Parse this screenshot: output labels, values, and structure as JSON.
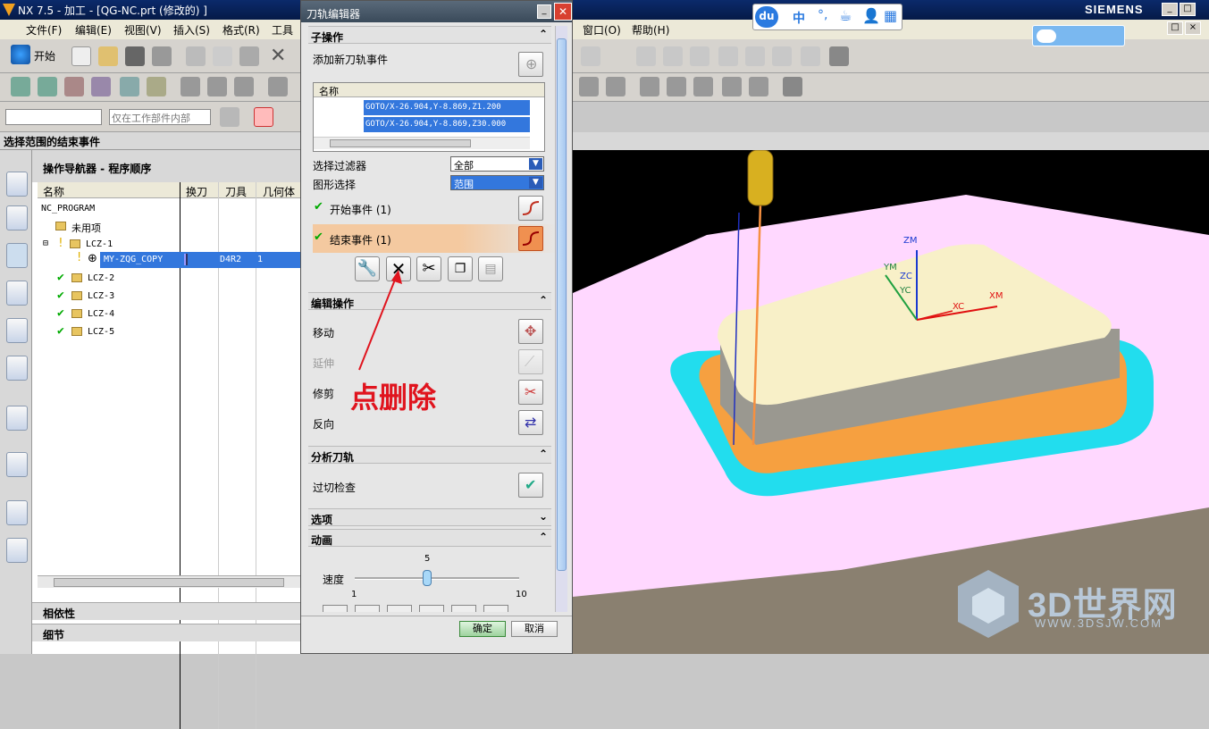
{
  "window": {
    "title": "NX 7.5 - 加工 - [QG-NC.prt (修改的) ]",
    "brand": "SIEMENS"
  },
  "menu": [
    "文件(F)",
    "编辑(E)",
    "视图(V)",
    "插入(S)",
    "格式(R)",
    "工具",
    "窗口(O)",
    "帮助(H)"
  ],
  "toolbar": {
    "start_label": "开始",
    "filter_placeholder": "仅在工作部件内部"
  },
  "selection_bar": {
    "label": "选择范围的结束事件"
  },
  "navigator": {
    "title": "操作导航器 - 程序顺序",
    "columns": [
      "名称",
      "换刀",
      "刀具",
      "几何体"
    ],
    "rows": [
      {
        "name": "NC_PROGRAM",
        "tool": "",
        "geom": ""
      },
      {
        "name": "未用项",
        "tool": "",
        "geom": ""
      },
      {
        "name": "LCZ-1",
        "tool": "",
        "geom": ""
      },
      {
        "name": "MY-ZQG_COPY",
        "tool": "D4R2",
        "geom": "1"
      },
      {
        "name": "LCZ-2",
        "tool": "",
        "geom": ""
      },
      {
        "name": "LCZ-3",
        "tool": "",
        "geom": ""
      },
      {
        "name": "LCZ-4",
        "tool": "",
        "geom": ""
      },
      {
        "name": "LCZ-5",
        "tool": "",
        "geom": ""
      }
    ],
    "bottom": [
      "相依性",
      "细节"
    ]
  },
  "dialog": {
    "title": "刀轨编辑器",
    "sub_ops_header": "子操作",
    "add_event": "添加新刀轨事件",
    "list_header": "名称",
    "events": [
      "GOTO/X-26.904,Y-8.869,Z1.200",
      "GOTO/X-26.904,Y-8.869,Z30.000"
    ],
    "filter_label": "选择过滤器",
    "filter_value": "全部",
    "graphic_label": "图形选择",
    "graphic_value": "范围",
    "start_event": "开始事件 (1)",
    "end_event": "结束事件 (1)",
    "edit_header": "编辑操作",
    "edit_items": [
      "移动",
      "延伸",
      "修剪",
      "反向"
    ],
    "analyze_header": "分析刀轨",
    "gouge": "过切检查",
    "options_header": "选项",
    "anim_header": "动画",
    "speed_label": "速度",
    "speed_value": "5",
    "speed_min": "1",
    "speed_max": "10",
    "ok": "确定",
    "cancel": "取消"
  },
  "annotation": {
    "text": "点删除"
  },
  "viewport": {
    "axes": [
      "ZM",
      "YM",
      "XM",
      "ZC",
      "YC",
      "XC"
    ]
  },
  "ime": {
    "logo": "du",
    "text": "中"
  },
  "watermark": {
    "brand": "3D世界网",
    "url": "WWW.3DSJW.COM"
  }
}
